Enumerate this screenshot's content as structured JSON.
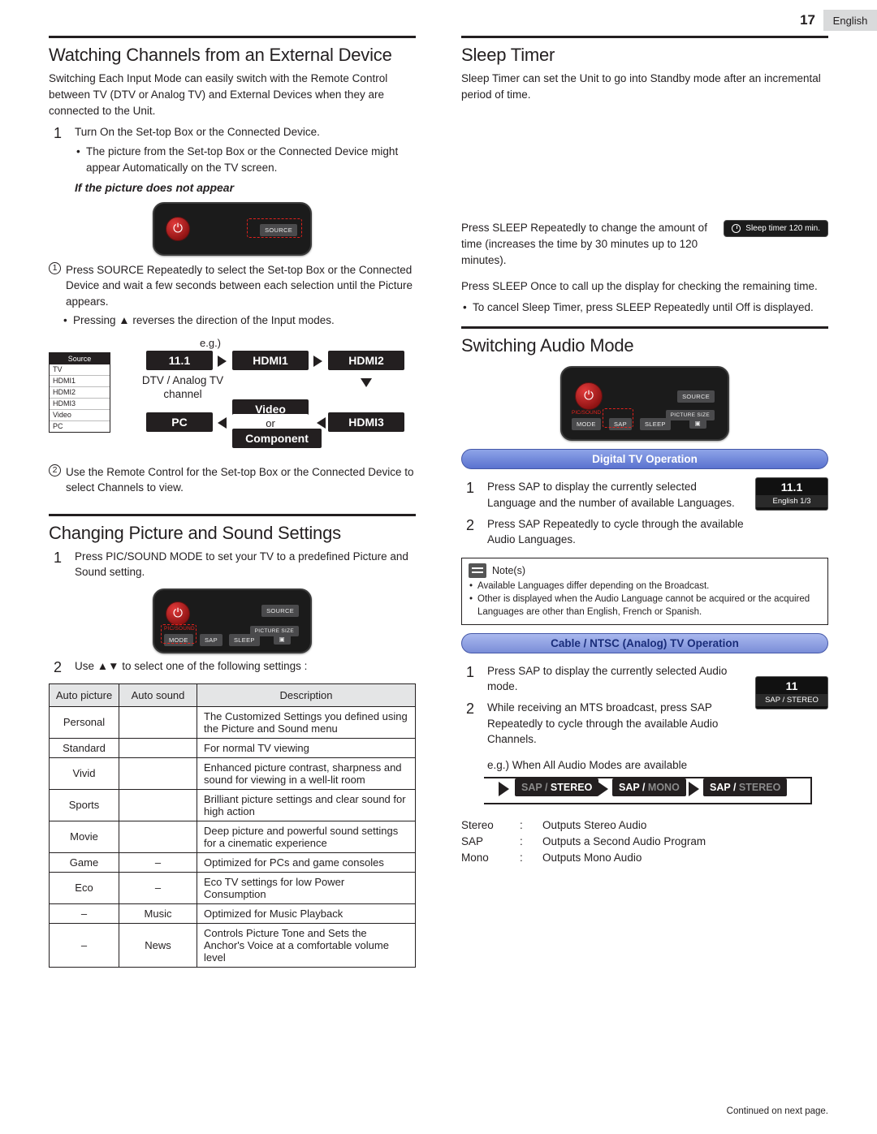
{
  "header": {
    "page_number": "17",
    "language": "English"
  },
  "left": {
    "section1": {
      "title": "Watching Channels from an External Device",
      "intro": "Switching Each Input Mode can easily switch with the Remote Control between TV (DTV or Analog TV) and External Devices when they are connected to the Unit.",
      "step1_num": "1",
      "step1_text": "Turn On the Set-top Box or the Connected Device.",
      "bullet1": "The picture from the Set-top Box or the Connected Device might appear Automatically on the TV screen.",
      "subhead": "If the picture does not appear",
      "remote": {
        "source_label": "SOURCE"
      },
      "item1": "Press SOURCE Repeatedly to select the Set-top Box or the Connected Device and wait a few seconds between each selection until the Picture appears.",
      "bullet2": "Pressing ▲ reverses the direction of the Input modes.",
      "eg_label": "e.g.)",
      "source_menu": {
        "title": "Source",
        "items": [
          "TV",
          "HDMI1",
          "HDMI2",
          "HDMI3",
          "Video",
          "PC"
        ]
      },
      "flow": {
        "chip_111": "11.1",
        "chip_hdmi1": "HDMI1",
        "chip_hdmi2": "HDMI2",
        "chip_hdmi3": "HDMI3",
        "chip_video": "Video",
        "chip_or": "or",
        "chip_component": "Component",
        "chip_pc": "PC",
        "caption_dtv": "DTV / Analog TV channel"
      },
      "item2": "Use the Remote Control for the Set-top Box or the Connected Device to select Channels to view."
    },
    "section2": {
      "title": "Changing Picture and Sound Settings",
      "step1_num": "1",
      "step1_text": "Press PIC/SOUND MODE to set your TV to a predefined Picture and Sound setting.",
      "remote_labels": {
        "source": "SOURCE",
        "picsound": "PIC/SOUND",
        "mode": "MODE",
        "sap": "SAP",
        "sleep": "SLEEP",
        "picture_size": "PICTURE SIZE"
      },
      "step2_num": "2",
      "step2_text": "Use ▲▼ to select one of the following settings :",
      "table": {
        "headers": [
          "Auto picture",
          "Auto sound",
          "Description"
        ],
        "rows": [
          {
            "auto_picture": "Personal",
            "auto_sound": "",
            "description": "The Customized Settings you defined using the Picture and Sound menu"
          },
          {
            "auto_picture": "Standard",
            "auto_sound": "",
            "description": "For normal TV viewing"
          },
          {
            "auto_picture": "Vivid",
            "auto_sound": "",
            "description": "Enhanced picture contrast, sharpness and sound for viewing in a well-lit room"
          },
          {
            "auto_picture": "Sports",
            "auto_sound": "",
            "description": "Brilliant picture settings and clear sound for high action"
          },
          {
            "auto_picture": "Movie",
            "auto_sound": "",
            "description": "Deep picture and powerful sound settings for a cinematic experience"
          },
          {
            "auto_picture": "Game",
            "auto_sound": "–",
            "description": "Optimized for PCs and game consoles"
          },
          {
            "auto_picture": "Eco",
            "auto_sound": "–",
            "description": "Eco TV settings for low Power Consumption"
          },
          {
            "auto_picture": "–",
            "auto_sound": "Music",
            "description": "Optimized for Music Playback"
          },
          {
            "auto_picture": "–",
            "auto_sound": "News",
            "description": "Controls Picture Tone and Sets the Anchor's Voice at a comfortable volume level"
          }
        ]
      }
    }
  },
  "right": {
    "section1": {
      "title": "Sleep Timer",
      "intro": "Sleep Timer can set the Unit to go into Standby mode after an incremental period of time.",
      "p1": "Press SLEEP Repeatedly to change the amount of time (increases the time by 30 minutes up to 120 minutes).",
      "osd_sleep": "Sleep timer   120 min.",
      "p2": "Press SLEEP Once to call up the display for checking the remaining time.",
      "bullet": "To cancel Sleep Timer, press SLEEP Repeatedly until Off is displayed."
    },
    "section2": {
      "title": "Switching Audio Mode",
      "remote_labels": {
        "source": "SOURCE",
        "picsound": "PIC/SOUND",
        "mode": "MODE",
        "sap": "SAP",
        "sleep": "SLEEP",
        "picture_size": "PICTURE SIZE"
      },
      "bar_digital": "Digital TV Operation",
      "d_step1_num": "1",
      "d_step1_text": "Press SAP to display the currently selected Language and the number of available Languages.",
      "osd_digital_big": "11.1",
      "osd_digital_sm": "English 1/3",
      "d_step2_num": "2",
      "d_step2_text": "Press SAP Repeatedly to cycle through the available Audio Languages.",
      "note_label": "Note(s)",
      "notes": [
        "Available Languages differ depending on the Broadcast.",
        "Other is displayed when the Audio Language cannot be acquired or the acquired Languages are other than English, French or Spanish."
      ],
      "bar_analog": "Cable / NTSC (Analog) TV Operation",
      "a_step1_num": "1",
      "a_step1_text": "Press SAP to display the currently selected Audio mode.",
      "a_step2_num": "2",
      "a_step2_text": "While receiving an MTS broadcast, press SAP Repeatedly to cycle through the available Audio Channels.",
      "osd_analog_big": "11",
      "osd_analog_sm": "SAP / STEREO",
      "eg_label": "e.g.) When All Audio Modes are available",
      "mode_chips": [
        {
          "a": "SAP",
          "b": " / ",
          "c": "STEREO",
          "dim": "a"
        },
        {
          "a": "SAP",
          "b": " / ",
          "c": "MONO",
          "dim": "c"
        },
        {
          "a": "SAP",
          "b": " / ",
          "c": "STEREO",
          "dim": "c"
        }
      ],
      "defs": [
        {
          "key": "Stereo",
          "sep": ":",
          "value": "Outputs Stereo Audio"
        },
        {
          "key": "SAP",
          "sep": ":",
          "value": "Outputs a Second Audio Program"
        },
        {
          "key": "Mono",
          "sep": ":",
          "value": "Outputs Mono Audio"
        }
      ]
    }
  },
  "footer": "Continued on next page."
}
